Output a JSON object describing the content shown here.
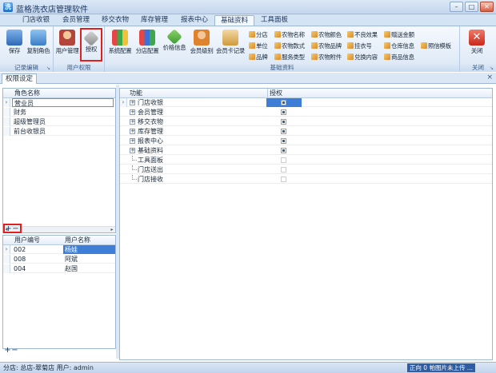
{
  "window": {
    "title": "蓝格洗衣店管理软件",
    "min": "–",
    "max": "□",
    "close": "✕"
  },
  "tabs": [
    "门店收银",
    "会员管理",
    "移交衣物",
    "库存管理",
    "报表中心",
    "基础资料",
    "工具面板"
  ],
  "active_tab": "基础资料",
  "ribbon": {
    "groups": [
      {
        "label": "记录编辑",
        "buttons": [
          {
            "label": "保存",
            "icon": "save-icon"
          },
          {
            "label": "复制角色",
            "icon": "copy-role-icon"
          }
        ]
      },
      {
        "label": "用户权限",
        "buttons": [
          {
            "label": "用户管理",
            "icon": "user-manage-icon"
          },
          {
            "label": "授权",
            "icon": "key-icon"
          }
        ]
      },
      {
        "label": "基础资料",
        "buttons": [
          {
            "label": "系统配置",
            "icon": "blocks-icon"
          },
          {
            "label": "分店配置",
            "icon": "blocks-icon"
          },
          {
            "label": "价格信息",
            "icon": "price-icon"
          },
          {
            "label": "会员级别",
            "icon": "member-level-icon"
          },
          {
            "label": "会员卡记录",
            "icon": "member-card-icon"
          }
        ],
        "small_buttons": [
          [
            "分店",
            "农物名称",
            "农物颜色",
            "不良效果",
            "赠送金额"
          ],
          [
            "单位",
            "农物款式",
            "农物品牌",
            "挂衣号",
            "仓库信息",
            "照信模板"
          ],
          [
            "品牌",
            "服务类型",
            "农物附件",
            "兑换内容",
            "商品信息"
          ]
        ]
      },
      {
        "label": "关闭",
        "buttons": [
          {
            "label": "关闭",
            "icon": "close-icon"
          }
        ]
      }
    ]
  },
  "doc_tab": {
    "label": "权限设定",
    "close": "×"
  },
  "roles": {
    "header": "角色名称",
    "rows": [
      "营业员",
      "财务",
      "超级管理员",
      "前台收银员"
    ],
    "selected": 0
  },
  "users": {
    "headers": [
      "用户编号",
      "用户名称"
    ],
    "rows": [
      [
        "002",
        "杨娃"
      ],
      [
        "008",
        "阿斌"
      ],
      [
        "004",
        "赵国"
      ]
    ],
    "selected": 0
  },
  "permissions": {
    "headers": [
      "功能",
      "授权"
    ],
    "rows": [
      {
        "label": "门店收银",
        "expandable": true,
        "checked": true,
        "selected": true
      },
      {
        "label": "会员管理",
        "expandable": true,
        "checked": true
      },
      {
        "label": "移交衣物",
        "expandable": true,
        "checked": true
      },
      {
        "label": "库存管理",
        "expandable": true,
        "checked": true
      },
      {
        "label": "报表中心",
        "expandable": true,
        "checked": true
      },
      {
        "label": "基础资料",
        "expandable": true,
        "checked": true
      },
      {
        "label": "工具面板",
        "expandable": false,
        "checked": false
      },
      {
        "label": "门店送出",
        "expandable": false,
        "checked": false
      },
      {
        "label": "门店接收",
        "expandable": false,
        "checked": false
      }
    ]
  },
  "pm": {
    "plus": "+",
    "minus": "−"
  },
  "status": {
    "left": "分店: 总店-翠菊店   用户: admin",
    "right": "正向 0 帕图片未上传 ..."
  },
  "colors": {
    "accent": "#3f7ed6",
    "highlight": "#e02020"
  }
}
